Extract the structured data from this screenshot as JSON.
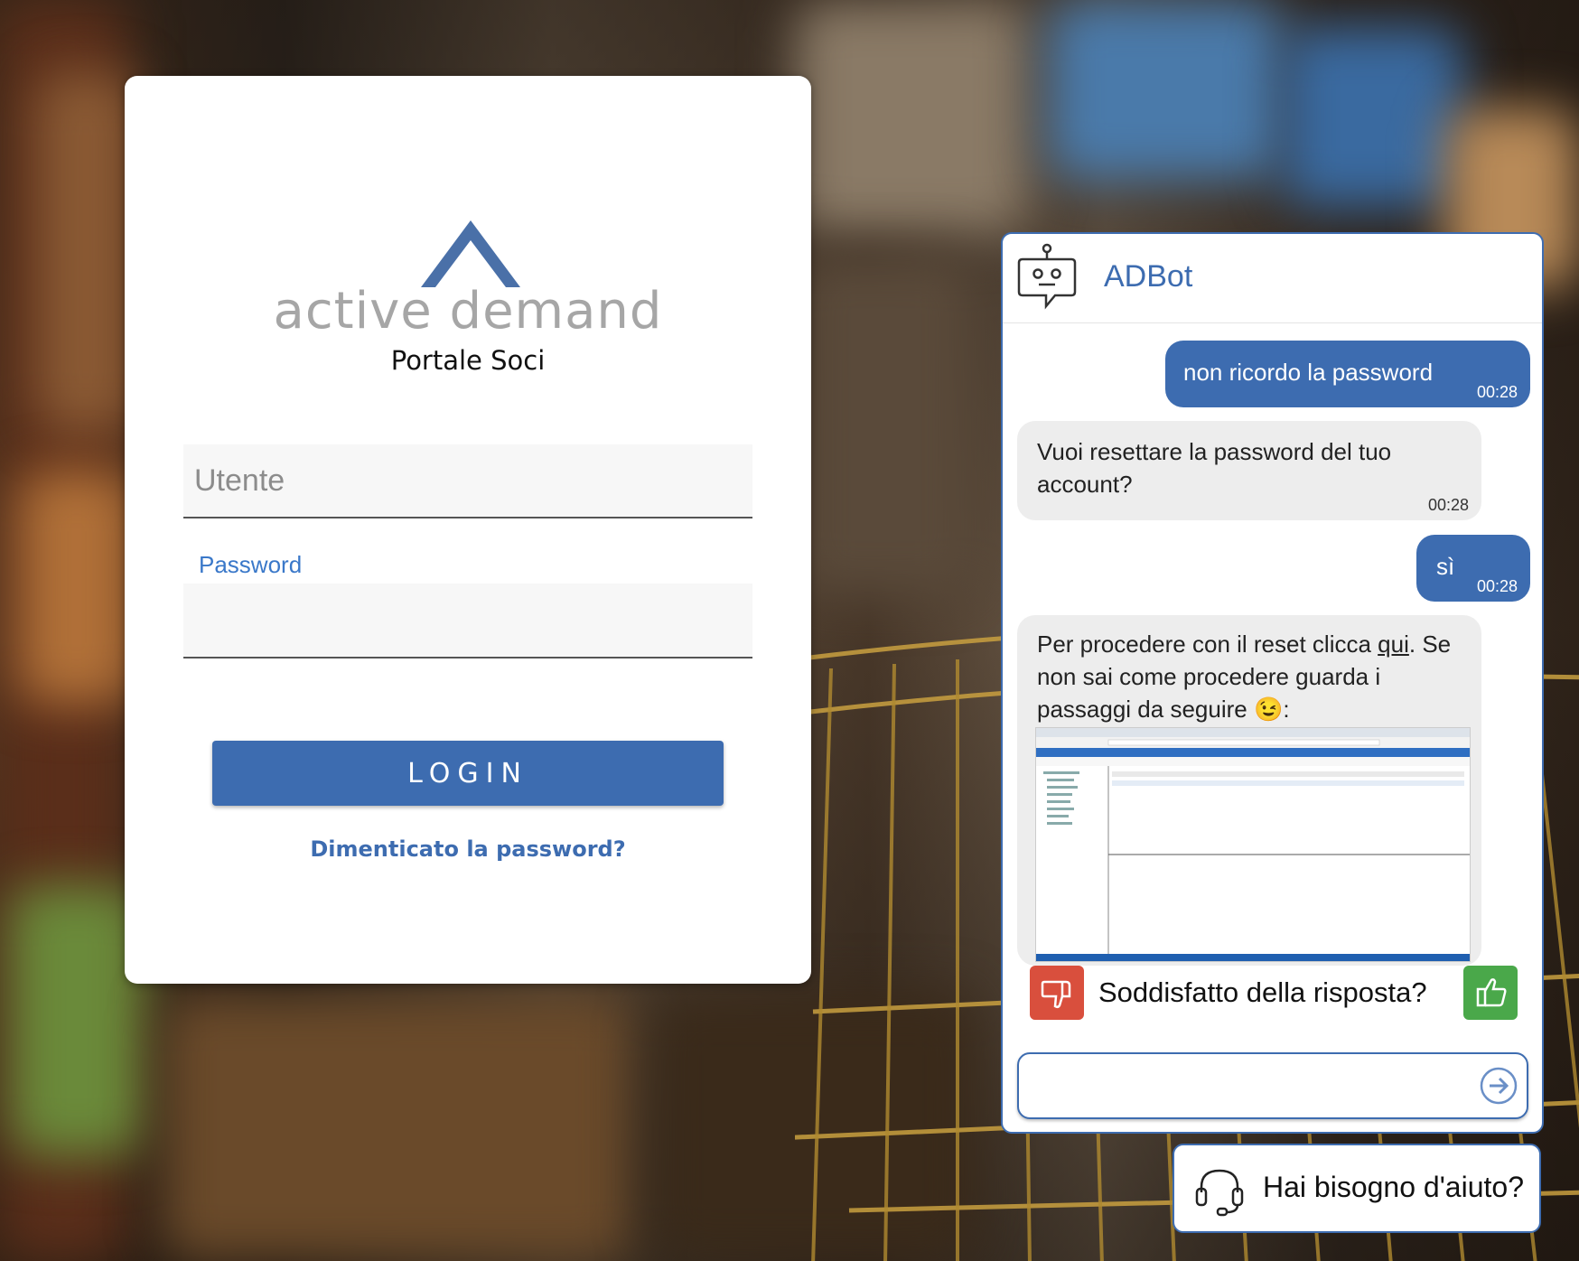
{
  "login": {
    "logo_text": "active demand",
    "logo_subtitle": "Portale Soci",
    "username_placeholder": "Utente",
    "password_label": "Password",
    "password_value": "",
    "login_button": "LOGIN",
    "forgot_link": "Dimenticato la password?"
  },
  "chat": {
    "title": "ADBot",
    "messages": [
      {
        "from": "user",
        "text": "non ricordo la password",
        "time": "00:28"
      },
      {
        "from": "bot",
        "text": "Vuoi resettare la password del tuo account?",
        "time": "00:28"
      },
      {
        "from": "user",
        "text": "sì",
        "time": "00:28"
      },
      {
        "from": "bot",
        "text_before_link": "Per procedere con il reset clicca ",
        "link": "qui",
        "text_after_link": ". Se non sai come procedere guarda i passaggi da seguire 😉:",
        "image": "screenshot-instructions"
      }
    ],
    "feedback_question": "Soddisfatto della risposta?",
    "input_value": ""
  },
  "help": {
    "label": "Hai bisogno d'aiuto?"
  },
  "colors": {
    "accent": "#3d6cb0",
    "thumb_down": "#d94f3d",
    "thumb_up": "#4aa84a"
  }
}
